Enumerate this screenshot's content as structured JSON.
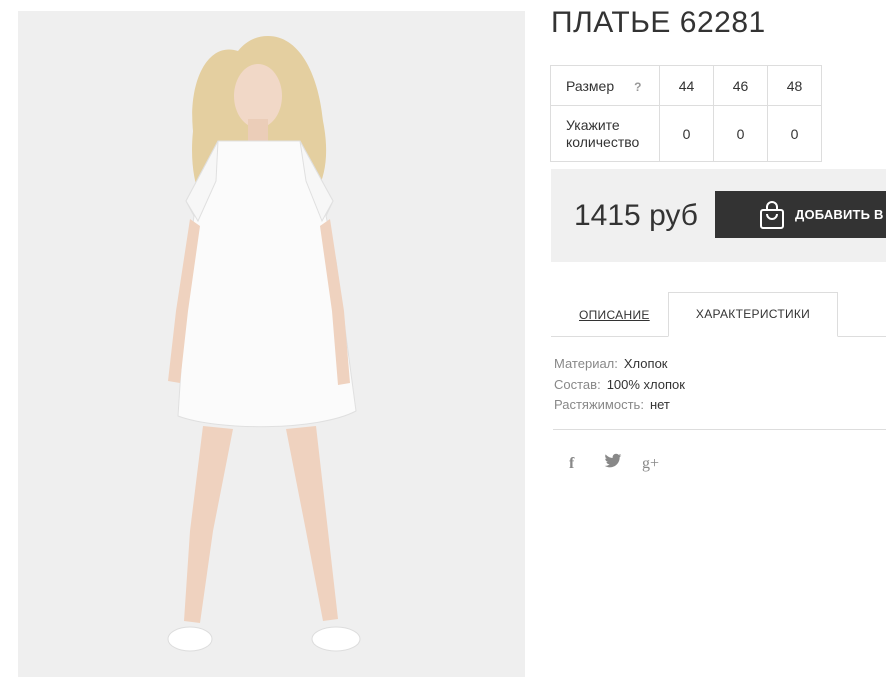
{
  "product": {
    "title": "ПЛАТЬЕ 62281",
    "image_alt": "Белое платье 62281"
  },
  "size_table": {
    "size_label": "Размер",
    "help_label": "?",
    "sizes": [
      "44",
      "46",
      "48"
    ],
    "quantity_label": "Укажите количество",
    "quantities": [
      "0",
      "0",
      "0"
    ]
  },
  "price": {
    "value": "1415 руб",
    "cart_button": "ДОБАВИТЬ В ЗАКАЗ"
  },
  "tabs": {
    "description": "ОПИСАНИЕ",
    "characteristics": "ХАРАКТЕРИСТИКИ"
  },
  "specs": [
    {
      "key": "Материал:",
      "value": "Хлопок"
    },
    {
      "key": "Состав:",
      "value": "100% хлопок"
    },
    {
      "key": "Растяжимость:",
      "value": "нет"
    }
  ],
  "social": {
    "facebook": "f",
    "twitter": "twitter-icon",
    "google_plus": "g+"
  },
  "colors": {
    "button_bg": "#333333",
    "price_bg": "#f0f0f0",
    "border": "#dddddd"
  }
}
